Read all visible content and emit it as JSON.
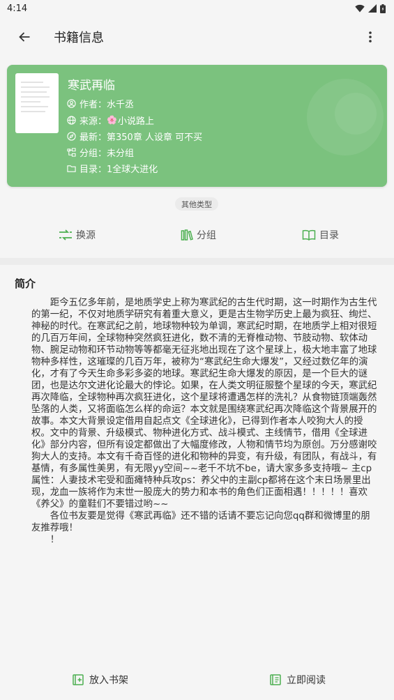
{
  "status_bar": {
    "time": "4:14",
    "icons": [
      "wifi-icon",
      "signal-icon",
      "battery-icon"
    ]
  },
  "app_bar": {
    "title": "书籍信息",
    "back_icon": "arrow-left-icon",
    "more_icon": "more-vertical-icon"
  },
  "book": {
    "title": "寒武再临",
    "author_label": "作者：",
    "author": "水千丞",
    "source_label": "来源：",
    "source": "小说路上",
    "latest_label": "最新：",
    "latest": "第350章 人设章 可不买",
    "group_label": "分组：",
    "group": "未分组",
    "toc_label": "目录：",
    "toc": "1全球大进化",
    "category": "其他类型"
  },
  "actions": {
    "change_source": "换源",
    "group": "分组",
    "catalog": "目录"
  },
  "intro": {
    "title": "简介",
    "text": "　　距今五亿多年前，是地质学史上称为寒武纪的古生代时期，这一时期作为古生代的第一纪，不仅对地质学研究有着重大意义，更是古生物学历史上最为疯狂、绚烂、神秘的时代。在寒武纪之前，地球物种较为单调，寒武纪时期，在地质学上相对很短的几百万年间，全球物种突然疯狂进化，数不清的无脊椎动物、节肢动物、软体动物、腕足动物和环节动物等等都毫无征兆地出现在了这个星球上，极大地丰富了地球物种多样性，这璀璨的几百万年，被称为“寒武纪生命大爆发”，又经过数亿年的演化，才有了今天生命多彩多姿的地球。寒武纪生命大爆发的原因，是一个巨大的谜团，也是达尔文进化论最大的悖论。如果，在人类文明征服整个星球的今天，寒武纪再次降临，全球物种再次疯狂进化，这个星球将遭遇怎样的洗礼？从食物链顶端轰然坠落的人类，又将面临怎么样的命运？本文就是围绕寒武纪再次降临这个背景展开的故事。本文大背景设定借用自起点文《全球进化》，已得到作者本人咬狗大人的授权。文中的背景、升级模式、物种进化方式、战斗模式、主线情节，借用《全球进化》部分内容，但所有设定都做出了大幅度修改，人物和情节均为原创。万分感谢咬狗大人的支持。本文有千奇百怪的进化和物种的异变，有升级，有团队，有战斗，有基情，有多属性美男，有无限yy空间~~老千不坑不be，请大家多多支持哦~ 主cp属性：人妻技术宅受和面瘫特种兵攻ps：养父中的主副cp都将在这个末日场景里出现，龙血一族将作为末世一股庞大的势力和本书的角色们正面相遇！！！！！喜欢《养父》的童鞋们不要错过哟~~\n　　各位书友要是觉得《寒武再临》还不错的话请不要忘记向您qq群和微博里的朋友推荐哦！\n　　！"
  },
  "bottom": {
    "add_shelf": "放入书架",
    "read_now": "立即阅读"
  },
  "colors": {
    "card": "#7bc27e",
    "accent": "#4caf50",
    "background": "#f5f5f5"
  }
}
